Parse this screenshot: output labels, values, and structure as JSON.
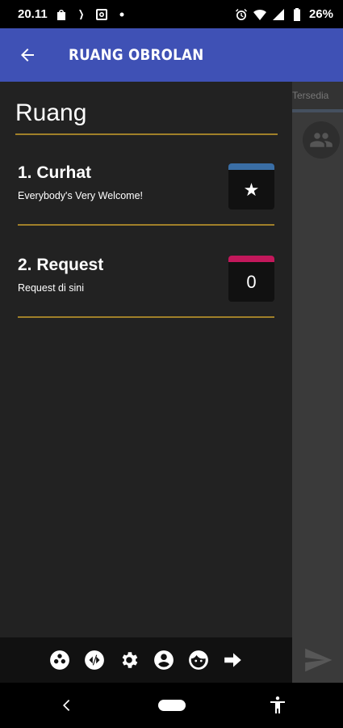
{
  "status_bar": {
    "time": "20.11",
    "battery": "26%",
    "icons": [
      "bag-icon",
      "nfc-icon",
      "instagram-icon",
      "dot-icon",
      "alarm-icon",
      "wifi-icon",
      "signal-icon",
      "battery-icon"
    ]
  },
  "app_bar": {
    "title": "RUANG OBROLAN",
    "back_icon": "arrow-left-icon"
  },
  "background": {
    "tab_label": "Tersedia",
    "people_icon": "people-icon",
    "send_icon": "send-icon"
  },
  "drawer": {
    "title": "Ruang",
    "rooms": [
      {
        "name": "1. Curhat",
        "description": "Everybody's Very Welcome!",
        "badge": "★",
        "badge_color": "#3a6ea5"
      },
      {
        "name": "2. Request",
        "description": "Request di sini",
        "badge": "0",
        "badge_color": "#c2185b"
      }
    ]
  },
  "toolbar": {
    "icons": [
      "dots-circle-icon",
      "code-circle-icon",
      "gear-icon",
      "account-icon",
      "face-icon",
      "arrow-right-icon"
    ]
  },
  "nav_bar": {
    "icons": [
      "nav-back-icon",
      "home-pill-icon",
      "accessibility-icon"
    ]
  },
  "colors": {
    "primary": "#3f51b5",
    "accent_line": "#a08029",
    "background": "#222222"
  }
}
